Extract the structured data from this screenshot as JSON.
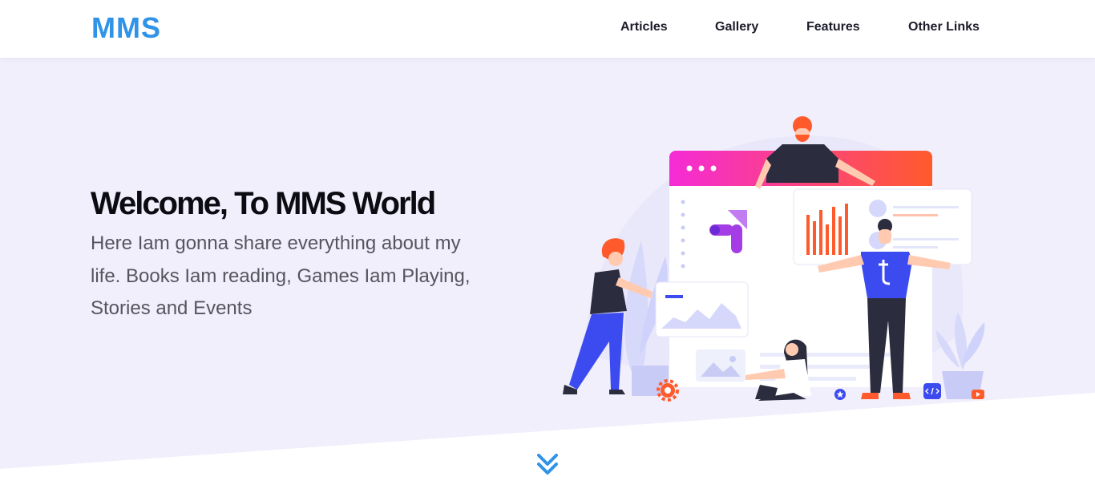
{
  "header": {
    "brand": "MMS",
    "nav": [
      {
        "label": "Articles"
      },
      {
        "label": "Gallery"
      },
      {
        "label": "Features"
      },
      {
        "label": "Other Links"
      }
    ]
  },
  "hero": {
    "title": "Welcome, To MMS World",
    "description": "Here Iam gonna share everything about my life. Books Iam reading, Games Iam Playing, Stories and Events"
  },
  "icons": {
    "scroll": "double-chevron-down-icon",
    "tablet_logo": "t-logo-icon",
    "gear": "gear-icon",
    "star": "star-icon",
    "code": "code-icon",
    "play": "play-icon"
  },
  "colors": {
    "brand": "#2f93e8",
    "hero_bg": "#f1effc",
    "accent_pink": "#f52bd6",
    "accent_orange": "#ff5a2c",
    "accent_blue": "#3b4bf0",
    "scroll_icon": "#2f93e8"
  }
}
